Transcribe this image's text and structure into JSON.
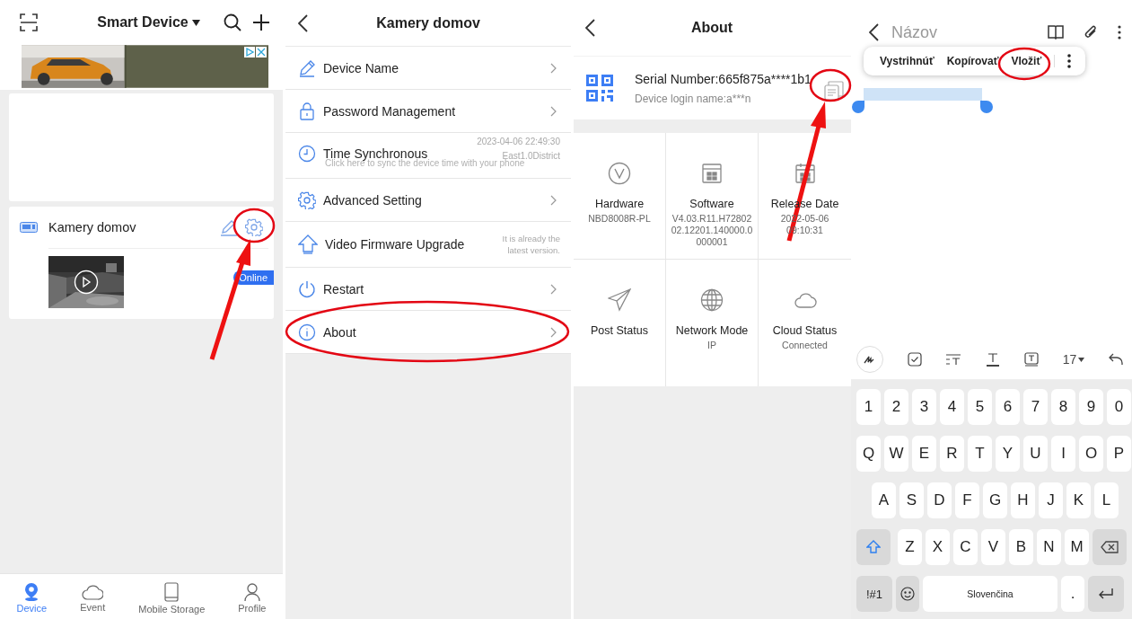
{
  "device_list": {
    "title": "Smart Device",
    "devices": [
      {
        "name": "Kamery domov",
        "status": "Online"
      }
    ],
    "bottom_nav": [
      {
        "label": "Device",
        "selected": true
      },
      {
        "label": "Event",
        "selected": false
      },
      {
        "label": "Mobile Storage",
        "selected": false
      },
      {
        "label": "Profile",
        "selected": false
      }
    ]
  },
  "device_settings": {
    "title": "Kamery domov",
    "items": [
      {
        "kind": "chevron",
        "label": "Device Name"
      },
      {
        "kind": "chevron",
        "label": "Password Management"
      },
      {
        "kind": "time",
        "label": "Time Synchronous",
        "detail": [
          "2023-04-06 22:49:30",
          "East1.0District"
        ],
        "hint": "Click here to sync the device time with your phone"
      },
      {
        "kind": "chevron",
        "label": "Advanced Setting"
      },
      {
        "kind": "note",
        "label": "Video Firmware Upgrade",
        "note": "It is already the latest version."
      },
      {
        "kind": "chevron",
        "label": "Restart"
      },
      {
        "kind": "chevron",
        "label": "About"
      }
    ]
  },
  "about": {
    "title": "About",
    "serial": "Serial Number:665f875a****1b1",
    "login": "Device login name:a***n",
    "cells": [
      {
        "title": "Hardware",
        "value": "NBD8008R-PL"
      },
      {
        "title": "Software",
        "value": "V4.03.R11.H7280202.12201.140000.0000001"
      },
      {
        "title": "Release Date",
        "value": "2022-05-06 09:10:31"
      },
      {
        "title": "Post Status"
      },
      {
        "title": "Network Mode",
        "value": "IP"
      },
      {
        "title": "Cloud Status",
        "value": "Connected"
      }
    ]
  },
  "notes": {
    "title_placeholder": "Názov",
    "context_menu": [
      "Vystrihnúť",
      "Kopírovať",
      "Vložiť"
    ],
    "font_size": "17",
    "keyboard": {
      "rows": [
        [
          "1",
          "2",
          "3",
          "4",
          "5",
          "6",
          "7",
          "8",
          "9",
          "0"
        ],
        [
          "Q",
          "W",
          "E",
          "R",
          "T",
          "Y",
          "U",
          "I",
          "O",
          "P"
        ],
        [
          "A",
          "S",
          "D",
          "F",
          "G",
          "H",
          "J",
          "K",
          "L"
        ],
        [
          "Z",
          "X",
          "C",
          "V",
          "B",
          "N",
          "M"
        ]
      ],
      "shift_on": true,
      "symbols": "!#1",
      "space": "Slovenčina",
      "period": "."
    }
  }
}
